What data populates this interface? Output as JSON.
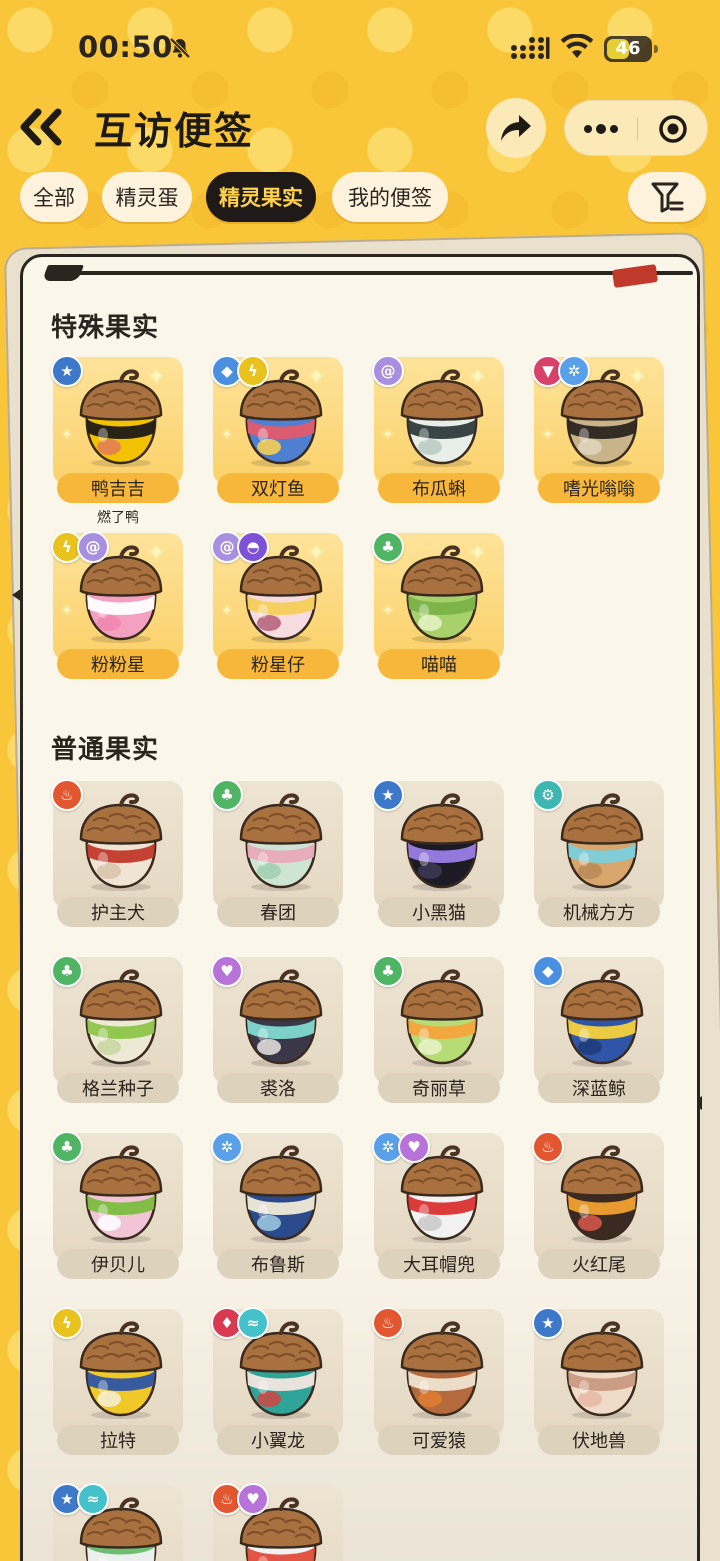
{
  "status": {
    "time": "00:50",
    "battery": "46"
  },
  "header": {
    "title": "互访便签"
  },
  "tabs": [
    {
      "label": "全部",
      "active": false
    },
    {
      "label": "精灵蛋",
      "active": false
    },
    {
      "label": "精灵果实",
      "active": true
    },
    {
      "label": "我的便签",
      "active": false
    }
  ],
  "colors": {
    "background": "#f9c63a",
    "active_tab": "#1f1a17",
    "active_tab_text": "#ffd24a"
  },
  "special": {
    "title": "特殊果实",
    "items": [
      {
        "name": "鸭吉吉",
        "sub": "燃了鸭",
        "types": [
          "star"
        ],
        "acorn": [
          "#f2c100",
          "#1d1a17",
          "#e07a5a"
        ]
      },
      {
        "name": "双灯鱼",
        "types": [
          "water",
          "electric"
        ],
        "acorn": [
          "#4f7fd1",
          "#e35b6c",
          "#ffd34d"
        ]
      },
      {
        "name": "布瓜蝌",
        "types": [
          "psychic"
        ],
        "acorn": [
          "#e8efe9",
          "#2f3b3c",
          "#b9c9c2"
        ]
      },
      {
        "name": "嗜光嗡嗡",
        "types": [
          "dark",
          "ice"
        ],
        "acorn": [
          "#c9b48a",
          "#2b2520",
          "#e0d6c0"
        ]
      },
      {
        "name": "粉粉星",
        "types": [
          "electric",
          "psychic"
        ],
        "acorn": [
          "#f4a0c0",
          "#ffffff",
          "#ee86b0"
        ]
      },
      {
        "name": "粉星仔",
        "types": [
          "psychic",
          "ghost"
        ],
        "acorn": [
          "#f6dbe0",
          "#f5cf5a",
          "#b35f7a"
        ]
      },
      {
        "name": "喵喵",
        "types": [
          "grass"
        ],
        "acorn": [
          "#a7d26b",
          "#7ab34a",
          "#e7f3c8"
        ]
      }
    ]
  },
  "normal": {
    "title": "普通果实",
    "items": [
      {
        "name": "护主犬",
        "types": [
          "fire"
        ],
        "acorn": [
          "#f0e4d4",
          "#c0392b",
          "#d8c2a8"
        ]
      },
      {
        "name": "春团",
        "types": [
          "grass"
        ],
        "acorn": [
          "#cfe5d3",
          "#e8aab8",
          "#9fcfb0"
        ]
      },
      {
        "name": "小黑猫",
        "types": [
          "star"
        ],
        "acorn": [
          "#1c1a24",
          "#9b7ee8",
          "#3e3a55"
        ]
      },
      {
        "name": "机械方方",
        "types": [
          "mech"
        ],
        "acorn": [
          "#d8a66c",
          "#7bcfdc",
          "#b78a58"
        ]
      },
      {
        "name": "格兰种子",
        "types": [
          "grass"
        ],
        "acorn": [
          "#eee9d4",
          "#8cc64b",
          "#c8d6a0"
        ]
      },
      {
        "name": "裘洛",
        "types": [
          "cute"
        ],
        "acorn": [
          "#3a3848",
          "#7fdad0",
          "#e8e4e0"
        ]
      },
      {
        "name": "奇丽草",
        "types": [
          "grass"
        ],
        "acorn": [
          "#b7db75",
          "#f3a53c",
          "#e9f3c9"
        ]
      },
      {
        "name": "深蓝鲸",
        "types": [
          "water"
        ],
        "acorn": [
          "#2f55a8",
          "#f5d23b",
          "#1f3b7a"
        ]
      },
      {
        "name": "伊贝儿",
        "types": [
          "grass"
        ],
        "acorn": [
          "#f2c5d6",
          "#7bbd3f",
          "#ffffff"
        ]
      },
      {
        "name": "布鲁斯",
        "types": [
          "ice"
        ],
        "acorn": [
          "#2a4a8c",
          "#f0ead8",
          "#9fcde0"
        ]
      },
      {
        "name": "大耳帽兜",
        "types": [
          "ice",
          "cute"
        ],
        "acorn": [
          "#f2f2f2",
          "#d93030",
          "#c9c9c9"
        ]
      },
      {
        "name": "火红尾",
        "types": [
          "fire"
        ],
        "acorn": [
          "#3b2a22",
          "#f0a030",
          "#d8584a"
        ]
      },
      {
        "name": "拉特",
        "types": [
          "electric"
        ],
        "acorn": [
          "#f0c928",
          "#2d55a5",
          "#f6f0d8"
        ]
      },
      {
        "name": "小翼龙",
        "types": [
          "dragon",
          "wing"
        ],
        "acorn": [
          "#2fa59a",
          "#f2e6e0",
          "#d2443f"
        ]
      },
      {
        "name": "可爱猿",
        "types": [
          "fire"
        ],
        "acorn": [
          "#b46a3c",
          "#f0e3cf",
          "#e07b30"
        ]
      },
      {
        "name": "伏地兽",
        "types": [
          "star"
        ],
        "acorn": [
          "#f0dbc8",
          "#c99a82",
          "#e6b9a6"
        ]
      },
      {
        "name": "",
        "types": [
          "star",
          "wing"
        ],
        "acorn": [
          "#6fbf72",
          "#f2f2f2",
          "#bfe0bf"
        ]
      },
      {
        "name": "",
        "types": [
          "fire",
          "cute"
        ],
        "acorn": [
          "#f2f2f2",
          "#e04b3a",
          "#d9d9d9"
        ]
      }
    ]
  }
}
